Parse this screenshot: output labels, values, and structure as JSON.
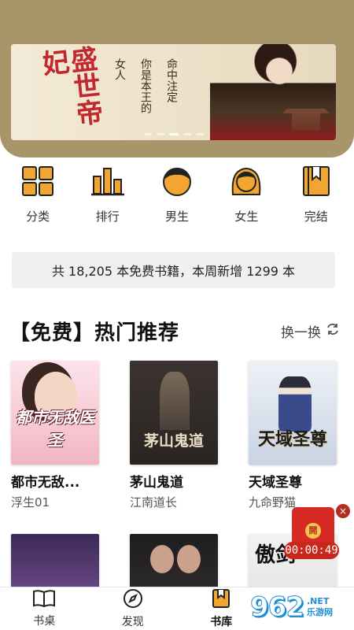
{
  "banner": {
    "calligraphy": "盛世帝妃",
    "poem": [
      "命中注定",
      "你是本王的",
      "女人"
    ],
    "dots": 5,
    "active_dot": 2
  },
  "categories": [
    {
      "label": "分类",
      "icon": "grid-icon"
    },
    {
      "label": "排行",
      "icon": "bar-chart-icon"
    },
    {
      "label": "男生",
      "icon": "boy-icon"
    },
    {
      "label": "女生",
      "icon": "girl-icon"
    },
    {
      "label": "完结",
      "icon": "bookmark-book-icon"
    }
  ],
  "notice": "共 18,205 本免费书籍，本周新增 1299 本",
  "section": {
    "title": "【免费】热门推荐",
    "refresh_label": "换一换"
  },
  "books": [
    {
      "title": "都市无敌...",
      "author": "浮生01",
      "cover_text": "都市无敌医圣"
    },
    {
      "title": "茅山鬼道",
      "author": "江南道长",
      "cover_text": "茅山鬼道"
    },
    {
      "title": "天域圣尊",
      "author": "九命野猫",
      "cover_text": "天域圣尊"
    },
    {
      "title": "",
      "author": "",
      "cover_text": ""
    },
    {
      "title": "",
      "author": "",
      "cover_text": ""
    },
    {
      "title": "",
      "author": "",
      "cover_text": "傲剑"
    }
  ],
  "floating": {
    "open_label": "開",
    "timer": "00:00:49",
    "close": "×"
  },
  "tabs": [
    {
      "label": "书桌",
      "icon": "book-open-icon"
    },
    {
      "label": "发现",
      "icon": "compass-icon"
    },
    {
      "label": "书库",
      "icon": "bookmark-icon",
      "active": true
    }
  ],
  "watermark": {
    "big": "962",
    "net": ".NET",
    "cn": "乐游网"
  },
  "colors": {
    "accent": "#f2a531",
    "hero_bg": "#a8956a",
    "notice_bg": "#f0f0f0",
    "envelope": "#d62b25"
  }
}
